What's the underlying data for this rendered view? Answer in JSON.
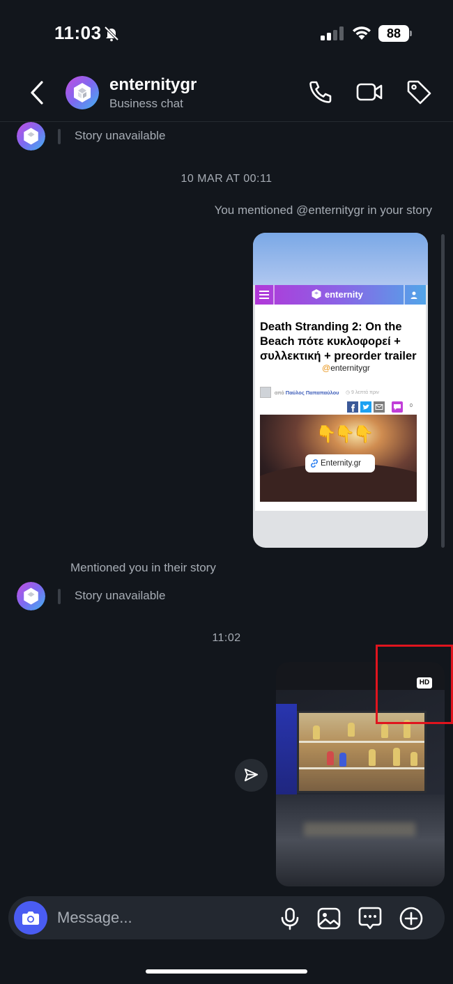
{
  "status_bar": {
    "time": "11:03",
    "battery": "88"
  },
  "header": {
    "name": "enternitygr",
    "subtitle": "Business chat"
  },
  "messages": {
    "story_unavailable_1": "Story unavailable",
    "timestamp_1": "10 MAR AT 00:11",
    "you_mentioned": "You mentioned @enternitygr in your story",
    "mentioned_you": "Mentioned you in their story",
    "story_unavailable_2": "Story unavailable",
    "timestamp_2": "11:02"
  },
  "story_card": {
    "brand": "enternity",
    "title": "Death Stranding 2: On the Beach πότε κυκλοφορεί + συλλεκτική + preorder trailer",
    "handle_at": "@",
    "handle": "enternitygr",
    "author_prefix": "από",
    "author": "Παύλος Παπαπαύλου",
    "time_ago": "◷ 9 λεπτά πριν",
    "comment_count": "0",
    "hands": "👇👇👇",
    "link_label": "Enternity.gr"
  },
  "photo": {
    "hd_badge": "HD"
  },
  "composer": {
    "placeholder": "Message..."
  },
  "colors": {
    "background": "#12161c",
    "accent": "#4a5cf2",
    "highlight": "#e0141e"
  }
}
